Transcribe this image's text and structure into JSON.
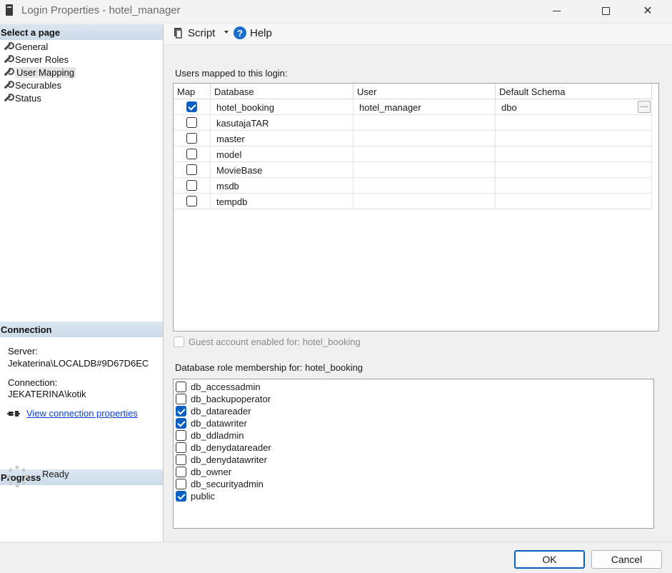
{
  "window": {
    "title": "Login Properties - hotel_manager"
  },
  "sidebar": {
    "select_page_header": "Select a page",
    "pages": [
      {
        "label": "General",
        "icon": "wrench-icon",
        "selected": false
      },
      {
        "label": "Server Roles",
        "icon": "wrench-icon",
        "selected": false
      },
      {
        "label": "User Mapping",
        "icon": "wrench-icon",
        "selected": true
      },
      {
        "label": "Securables",
        "icon": "wrench-icon",
        "selected": false
      },
      {
        "label": "Status",
        "icon": "wrench-icon",
        "selected": false
      }
    ],
    "connection_header": "Connection",
    "server_label": "Server:",
    "server_value": "Jekaterina\\LOCALDB#9D67D6EC",
    "connection_label": "Connection:",
    "connection_value": "JEKATERINA\\kotik",
    "view_connection_link": "View connection properties",
    "progress_header": "Progress",
    "progress_status": "Ready"
  },
  "toolbar": {
    "script_label": "Script",
    "help_label": "Help"
  },
  "mapping": {
    "section_label": "Users mapped to this login:",
    "columns": {
      "map": "Map",
      "database": "Database",
      "user": "User",
      "schema": "Default Schema"
    },
    "rows": [
      {
        "checked": true,
        "database": "hotel_booking",
        "user": "hotel_manager",
        "schema": "dbo"
      },
      {
        "checked": false,
        "database": "kasutajaTAR",
        "user": "",
        "schema": ""
      },
      {
        "checked": false,
        "database": "master",
        "user": "",
        "schema": ""
      },
      {
        "checked": false,
        "database": "model",
        "user": "",
        "schema": ""
      },
      {
        "checked": false,
        "database": "MovieBase",
        "user": "",
        "schema": ""
      },
      {
        "checked": false,
        "database": "msdb",
        "user": "",
        "schema": ""
      },
      {
        "checked": false,
        "database": "tempdb",
        "user": "",
        "schema": ""
      }
    ],
    "ellipsis_label": "...."
  },
  "guest": {
    "label": "Guest account enabled for: hotel_booking",
    "checked": false
  },
  "roles": {
    "section_label": "Database role membership for: hotel_booking",
    "items": [
      {
        "label": "db_accessadmin",
        "checked": false
      },
      {
        "label": "db_backupoperator",
        "checked": false
      },
      {
        "label": "db_datareader",
        "checked": true
      },
      {
        "label": "db_datawriter",
        "checked": true
      },
      {
        "label": "db_ddladmin",
        "checked": false
      },
      {
        "label": "db_denydatareader",
        "checked": false
      },
      {
        "label": "db_denydatawriter",
        "checked": false
      },
      {
        "label": "db_owner",
        "checked": false
      },
      {
        "label": "db_securityadmin",
        "checked": false
      },
      {
        "label": "public",
        "checked": true
      }
    ]
  },
  "footer": {
    "ok_label": "OK",
    "cancel_label": "Cancel"
  },
  "colors": {
    "accent": "#0a5fc2",
    "section_header": "#d5e2ee",
    "link": "#0b3fd6"
  }
}
